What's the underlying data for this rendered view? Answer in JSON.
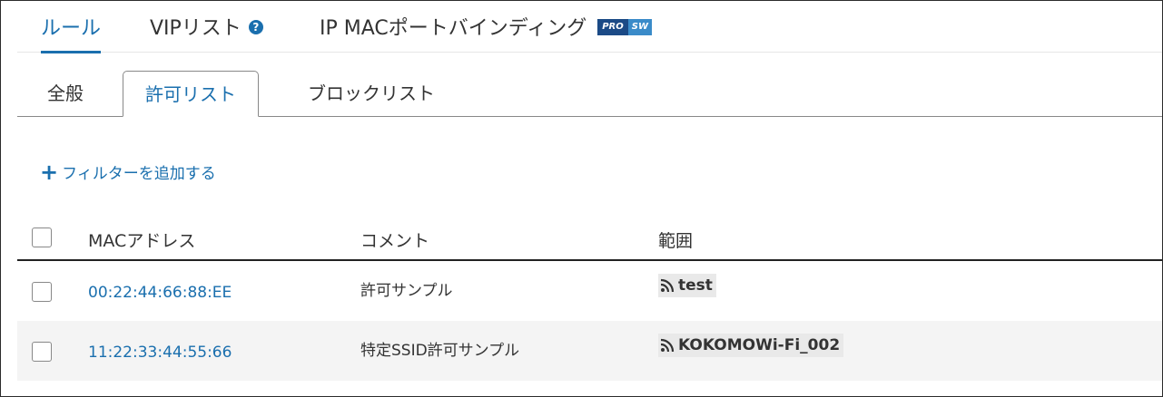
{
  "top_tabs": [
    {
      "label": "ルール",
      "active": true
    },
    {
      "label": "VIPリスト",
      "icon": "help-icon"
    },
    {
      "label": "IP MACポートバインディング",
      "badge": [
        "PRO",
        "SW"
      ]
    }
  ],
  "help_icon_glyph": "?",
  "sub_tabs": [
    {
      "label": "全般"
    },
    {
      "label": "許可リスト",
      "active": true
    },
    {
      "label": "ブロックリスト"
    }
  ],
  "add_filter": {
    "icon": "plus-icon",
    "glyph": "+",
    "label": "フィルターを追加する"
  },
  "table": {
    "headers": {
      "mac": "MACアドレス",
      "comment": "コメント",
      "scope": "範囲"
    },
    "rows": [
      {
        "mac": "00:22:44:66:88:EE",
        "comment": "許可サンプル",
        "scope": "test",
        "scope_icon": "rss-icon"
      },
      {
        "mac": "11:22:33:44:55:66",
        "comment": "特定SSID許可サンプル",
        "scope": "KOKOMOWi-Fi_002",
        "scope_icon": "rss-icon"
      }
    ]
  },
  "colors": {
    "accent": "#1a6fae",
    "badge_pro": "#1b4a86",
    "badge_sw": "#3a8bc9",
    "row_alt": "#f4f4f4"
  }
}
